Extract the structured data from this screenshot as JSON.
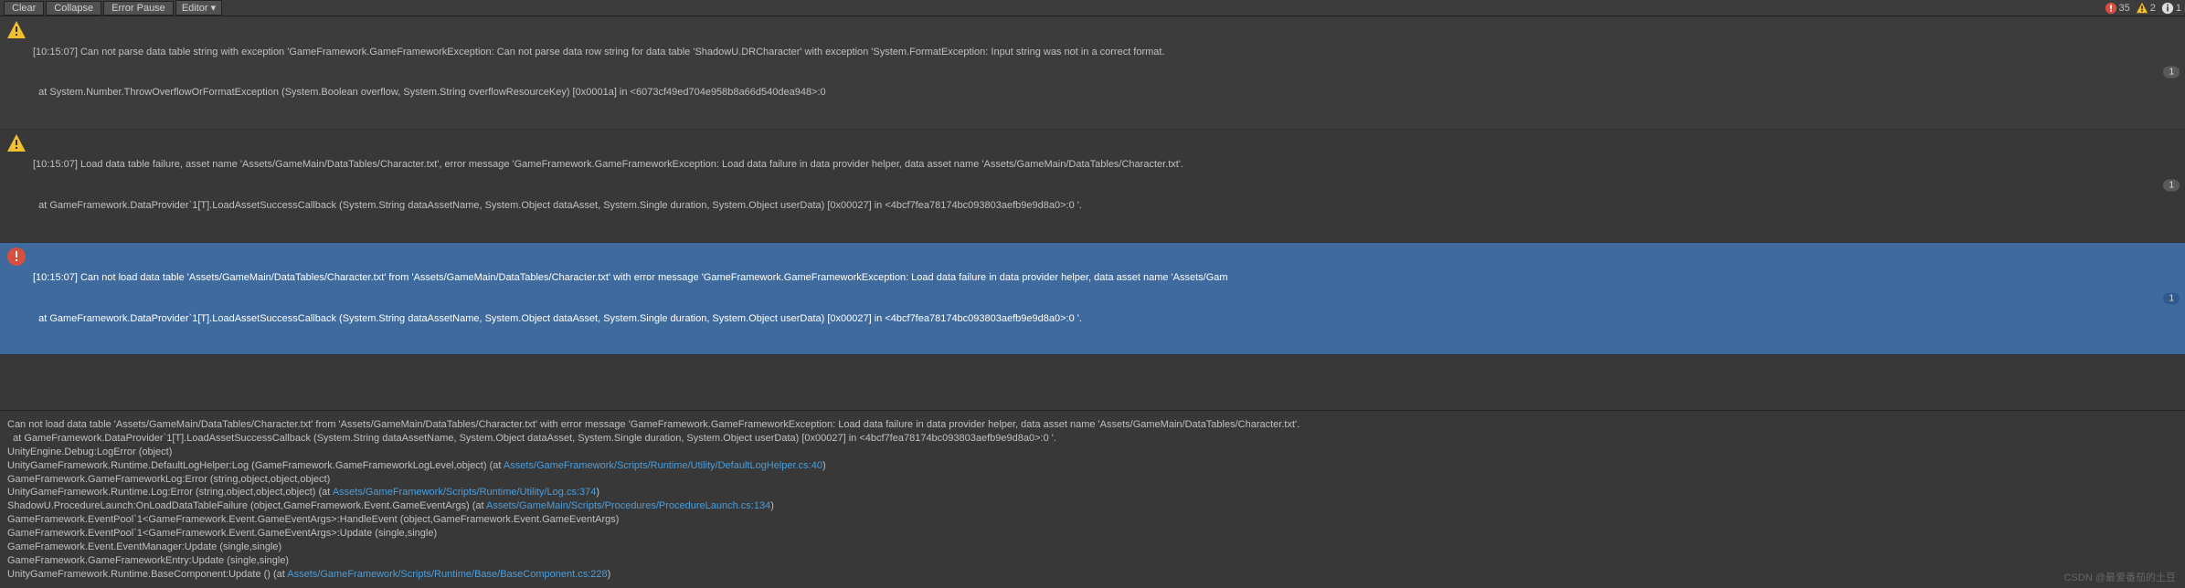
{
  "toolbar": {
    "clear": "Clear",
    "collapse": "Collapse",
    "error_pause": "Error Pause",
    "editor": "Editor ▾"
  },
  "counters": {
    "error_count": "35",
    "warn_count": "2",
    "info_count": "1"
  },
  "entries": [
    {
      "icon": "warning",
      "count": "1",
      "line1": "[10:15:07] Can not parse data table string with exception 'GameFramework.GameFrameworkException: Can not parse data row string for data table 'ShadowU.DRCharacter' with exception 'System.FormatException: Input string was not in a correct format.",
      "line2": "  at System.Number.ThrowOverflowOrFormatException (System.Boolean overflow, System.String overflowResourceKey) [0x0001a] in <6073cf49ed704e958b8a66d540dea948>:0"
    },
    {
      "icon": "warning",
      "count": "1",
      "line1": "[10:15:07] Load data table failure, asset name 'Assets/GameMain/DataTables/Character.txt', error message 'GameFramework.GameFrameworkException: Load data failure in data provider helper, data asset name 'Assets/GameMain/DataTables/Character.txt'.",
      "line2": "  at GameFramework.DataProvider`1[T].LoadAssetSuccessCallback (System.String dataAssetName, System.Object dataAsset, System.Single duration, System.Object userData) [0x00027] in <4bcf7fea78174bc093803aefb9e9d8a0>:0 '."
    },
    {
      "icon": "error",
      "count": "1",
      "selected": true,
      "line1": "[10:15:07] Can not load data table 'Assets/GameMain/DataTables/Character.txt' from 'Assets/GameMain/DataTables/Character.txt' with error message 'GameFramework.GameFrameworkException: Load data failure in data provider helper, data asset name 'Assets/Gam",
      "line2": "  at GameFramework.DataProvider`1[T].LoadAssetSuccessCallback (System.String dataAssetName, System.Object dataAsset, System.Single duration, System.Object userData) [0x00027] in <4bcf7fea78174bc093803aefb9e9d8a0>:0 '."
    }
  ],
  "detail": {
    "lines": [
      {
        "t": "Can not load data table 'Assets/GameMain/DataTables/Character.txt' from 'Assets/GameMain/DataTables/Character.txt' with error message 'GameFramework.GameFrameworkException: Load data failure in data provider helper, data asset name 'Assets/GameMain/DataTables/Character.txt'."
      },
      {
        "t": "  at GameFramework.DataProvider`1[T].LoadAssetSuccessCallback (System.String dataAssetName, System.Object dataAsset, System.Single duration, System.Object userData) [0x00027] in <4bcf7fea78174bc093803aefb9e9d8a0>:0 '."
      },
      {
        "t": "UnityEngine.Debug:LogError (object)"
      },
      {
        "pre": "UnityGameFramework.Runtime.DefaultLogHelper:Log (GameFramework.GameFrameworkLogLevel,object) (at ",
        "link": "Assets/GameFramework/Scripts/Runtime/Utility/DefaultLogHelper.cs:40",
        "post": ")"
      },
      {
        "t": "GameFramework.GameFrameworkLog:Error (string,object,object,object)"
      },
      {
        "pre": "UnityGameFramework.Runtime.Log:Error (string,object,object,object) (at ",
        "link": "Assets/GameFramework/Scripts/Runtime/Utility/Log.cs:374",
        "post": ")"
      },
      {
        "pre": "ShadowU.ProcedureLaunch:OnLoadDataTableFailure (object,GameFramework.Event.GameEventArgs) (at ",
        "link": "Assets/GameMain/Scripts/Procedures/ProcedureLaunch.cs:134",
        "post": ")"
      },
      {
        "t": "GameFramework.EventPool`1<GameFramework.Event.GameEventArgs>:HandleEvent (object,GameFramework.Event.GameEventArgs)"
      },
      {
        "t": "GameFramework.EventPool`1<GameFramework.Event.GameEventArgs>:Update (single,single)"
      },
      {
        "t": "GameFramework.Event.EventManager:Update (single,single)"
      },
      {
        "t": "GameFramework.GameFrameworkEntry:Update (single,single)"
      },
      {
        "pre": "UnityGameFramework.Runtime.BaseComponent:Update () (at ",
        "link": "Assets/GameFramework/Scripts/Runtime/Base/BaseComponent.cs:228",
        "post": ")"
      }
    ]
  },
  "watermark": "CSDN @最爱番茄的土豆"
}
